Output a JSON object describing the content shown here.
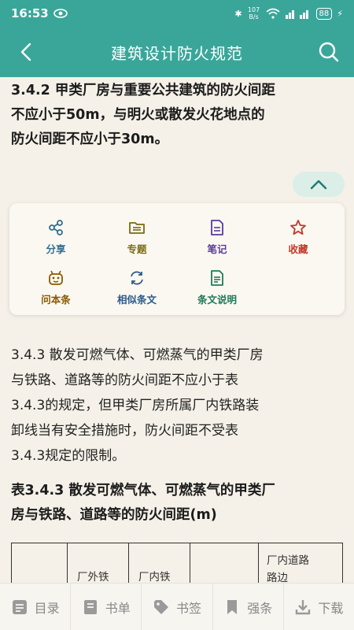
{
  "status": {
    "time": "16:53",
    "net_speed": "107 B/s",
    "battery": "88"
  },
  "app": {
    "title": "建筑设计防火规范"
  },
  "content": {
    "clause_342": [
      "3.4.2 甲类厂房与重要公共建筑的防火间距",
      "不应小于50m，与明火或散发火花地点的",
      "防火间距不应小于30m。"
    ],
    "actions": [
      {
        "label": "分享",
        "icon": "share-icon",
        "color": "#2f6f8f"
      },
      {
        "label": "专题",
        "icon": "folder-icon",
        "color": "#7a6a10"
      },
      {
        "label": "笔记",
        "icon": "note-icon",
        "color": "#5a3a9a"
      },
      {
        "label": "收藏",
        "icon": "star-icon",
        "color": "#c0392b"
      },
      {
        "label": "问本条",
        "icon": "robot-icon",
        "color": "#8a5a00"
      },
      {
        "label": "相似条文",
        "icon": "similar-icon",
        "color": "#2a5a8a"
      },
      {
        "label": "条文说明",
        "icon": "document-icon",
        "color": "#1f7a5a"
      }
    ],
    "clause_343": [
      "3.4.3 散发可燃气体、可燃蒸气的甲类厂房",
      "与铁路、道路等的防火间距不应小于表",
      "3.4.3的规定，但甲类厂房所属厂内铁路装",
      "卸线当有安全措施时，防火间距不受表",
      "3.4.3规定的限制。"
    ],
    "table_title": [
      "表3.4.3 散发可燃气体、可燃蒸气的甲类厂",
      "房与铁路、道路等的防火间距(m)"
    ],
    "table_headers": [
      "",
      "厂外铁",
      "厂内铁",
      "",
      "厂内道路\n路边"
    ]
  },
  "bottom_nav": [
    {
      "label": "目录",
      "icon": "catalog-icon"
    },
    {
      "label": "书单",
      "icon": "booklist-icon"
    },
    {
      "label": "书签",
      "icon": "tag-icon"
    },
    {
      "label": "强条",
      "icon": "bookmark-icon"
    },
    {
      "label": "下载",
      "icon": "download-icon"
    }
  ]
}
